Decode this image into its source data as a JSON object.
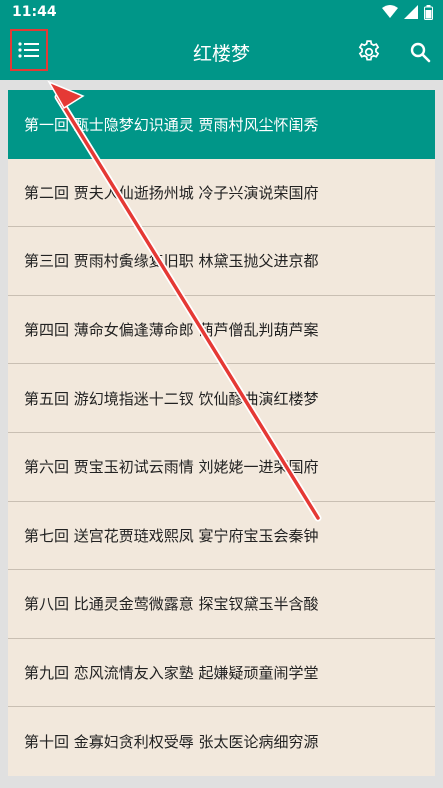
{
  "status": {
    "time": "11:44"
  },
  "appbar": {
    "title": "红楼梦"
  },
  "icons": {
    "menu": "list-icon",
    "settings": "gear-icon",
    "search": "search-icon"
  },
  "colors": {
    "primary": "#009688",
    "list_bg": "#f2e8dc",
    "highlight": "#e53935"
  },
  "chapters": [
    {
      "label": "第一回 甄士隐梦幻识通灵 贾雨村风尘怀闺秀",
      "active": true
    },
    {
      "label": "第二回 贾夫人仙逝扬州城 冷子兴演说荣国府"
    },
    {
      "label": "第三回 贾雨村夤缘复旧职 林黛玉抛父进京都"
    },
    {
      "label": "第四回 薄命女偏逢薄命郎 葫芦僧乱判葫芦案"
    },
    {
      "label": "第五回 游幻境指迷十二钗 饮仙醪曲演红楼梦"
    },
    {
      "label": "第六回 贾宝玉初试云雨情 刘姥姥一进荣国府"
    },
    {
      "label": "第七回 送宫花贾琏戏熙凤 宴宁府宝玉会秦钟"
    },
    {
      "label": "第八回 比通灵金莺微露意 探宝钗黛玉半含酸"
    },
    {
      "label": "第九回 恋风流情友入家塾 起嫌疑顽童闹学堂"
    },
    {
      "label": "第十回 金寡妇贪利权受辱 张太医论病细穷源"
    }
  ]
}
